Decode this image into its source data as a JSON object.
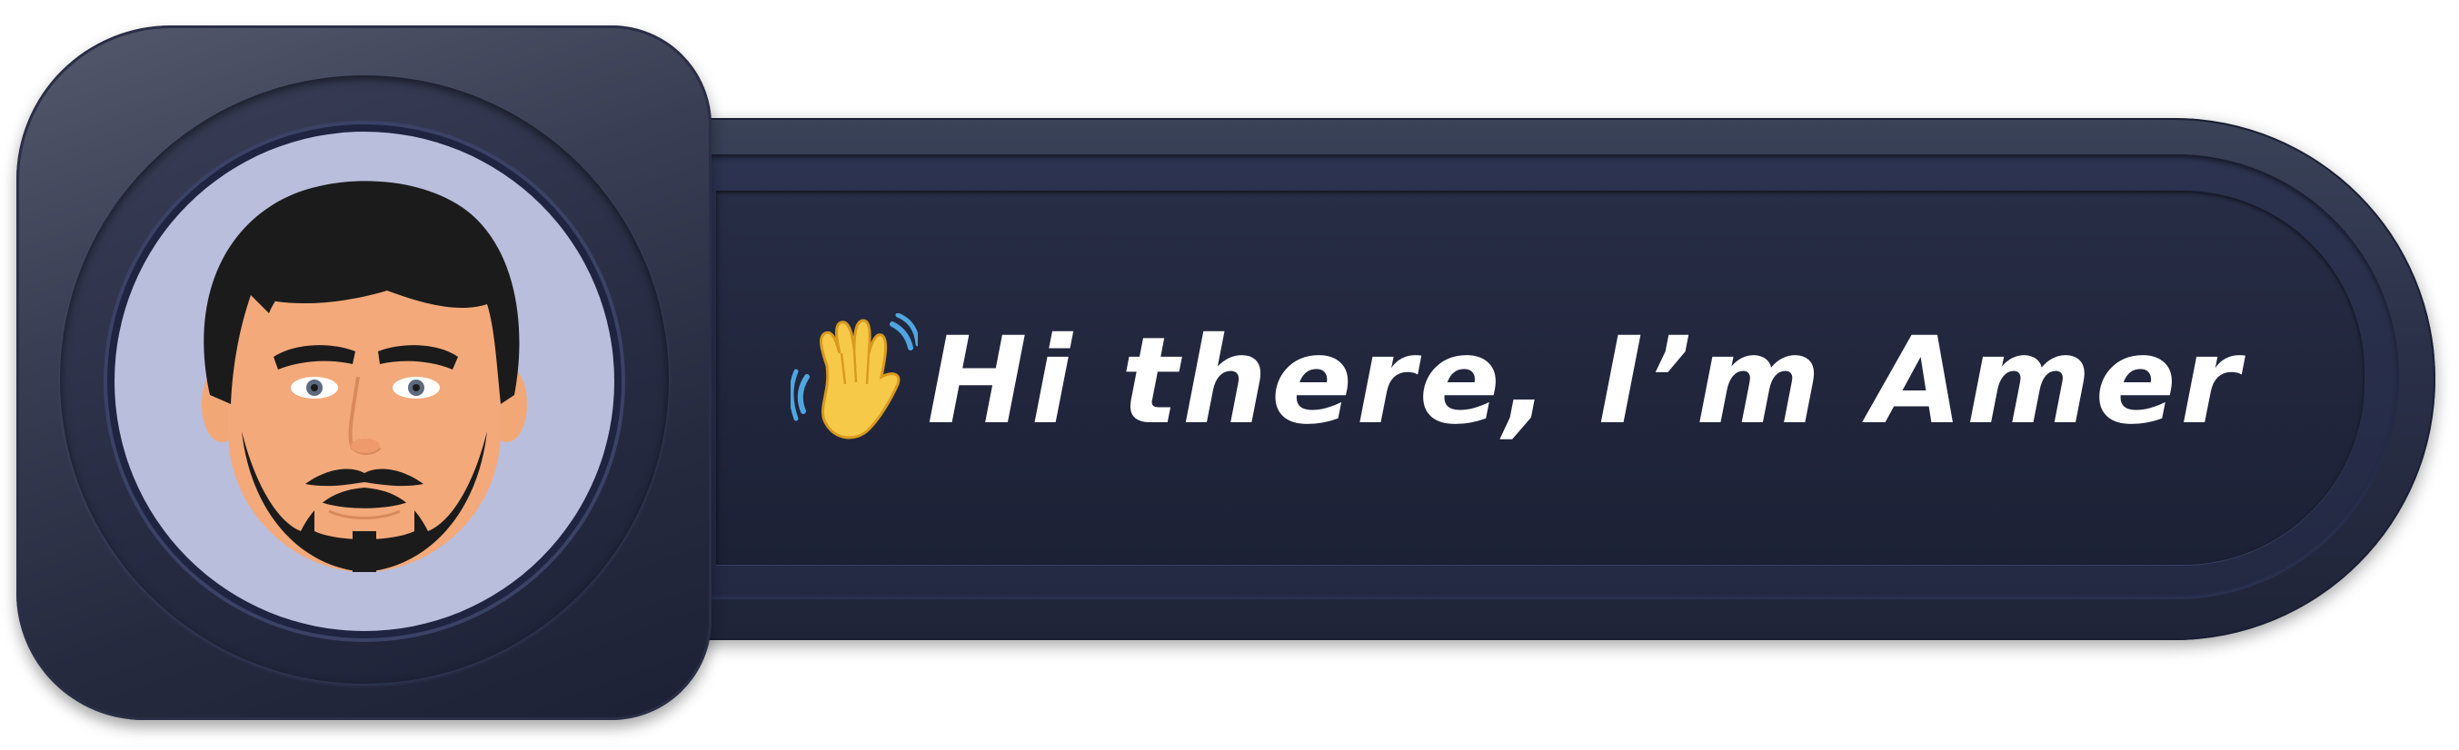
{
  "greeting": {
    "text": "Hi there, I’m Amer",
    "icon": "waving-hand-icon"
  },
  "avatar": {
    "icon": "avatar-face-icon"
  },
  "colors": {
    "banner": "#2a3048",
    "avatar_background": "#b9bedc",
    "text": "#ffffff"
  }
}
